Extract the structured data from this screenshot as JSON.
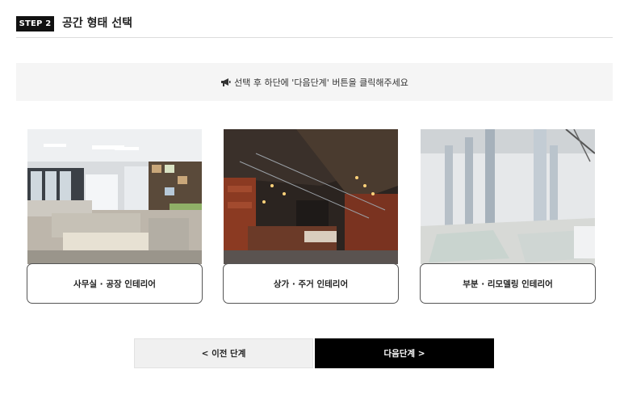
{
  "header": {
    "step_badge": "STEP 2",
    "title": "공간 형태 선택"
  },
  "notice": {
    "icon": "megaphone-icon",
    "text": "선택 후 하단에 '다음단계' 버튼을 클릭해주세요"
  },
  "options": [
    {
      "label": "사무실 · 공장 인테리어",
      "image": "office-cubicles-photo"
    },
    {
      "label": "상가 · 주거 인테리어",
      "image": "commercial-interior-photo"
    },
    {
      "label": "부분 · 리모델링 인테리어",
      "image": "demolition-remodel-photo"
    }
  ],
  "buttons": {
    "prev": "< 이전 단계",
    "next": "다음단계 >"
  },
  "colors": {
    "accent_dark": "#000000",
    "notice_bg": "#f5f5f5"
  }
}
